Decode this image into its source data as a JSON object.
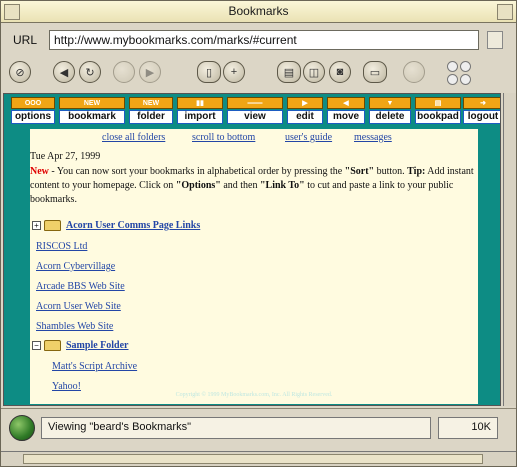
{
  "window": {
    "title": "Bookmarks"
  },
  "urlbar": {
    "label": "URL",
    "value": "http://www.mybookmarks.com/marks/#current"
  },
  "nav": {
    "buttons": [
      "stop",
      "back",
      "reload",
      "forward",
      "home",
      "page-view",
      "new-page",
      "hotlist",
      "history",
      "save",
      "print",
      "search"
    ]
  },
  "toolbar": {
    "items": [
      {
        "label": "options",
        "icon": "OOO"
      },
      {
        "label": "bookmark",
        "icon": "NEW"
      },
      {
        "label": "folder",
        "icon": "NEW"
      },
      {
        "label": "import",
        "icon": "▮▮"
      },
      {
        "label": "view",
        "icon": "═══"
      },
      {
        "label": "edit",
        "icon": "▶"
      },
      {
        "label": "move",
        "icon": "◀"
      },
      {
        "label": "delete",
        "icon": "▼"
      },
      {
        "label": "bookpad",
        "icon": "▤"
      },
      {
        "label": "logout",
        "icon": "➜"
      }
    ]
  },
  "page": {
    "top_links": [
      "close all folders",
      "scroll to bottom",
      "user's guide",
      "messages"
    ],
    "date": "Tue Apr 27, 1999",
    "news": {
      "new_label": "New",
      "text_part1": " - You can now sort your bookmarks in alphabetical order by pressing the ",
      "sort_word": "\"Sort\"",
      "text_part2": " button. ",
      "tip_word": "Tip:",
      "text_part3": " Add instant content to your homepage. Click on ",
      "options_word": "\"Options\"",
      "text_part4": " and then ",
      "linkto_word": "\"Link To\"",
      "text_part5": " to cut and paste a link to your public bookmarks."
    },
    "bookmarks": [
      {
        "label": "Acorn User Comms Page Links",
        "folder": true,
        "expanded": false
      },
      {
        "label": "RISCOS Ltd",
        "folder": false
      },
      {
        "label": "Acorn Cybervillage",
        "folder": false
      },
      {
        "label": "Arcade BBS Web Site",
        "folder": false
      },
      {
        "label": "Acorn User Web Site",
        "folder": false
      },
      {
        "label": "Shambles Web Site",
        "folder": false
      },
      {
        "label": "Sample Folder",
        "folder": true,
        "expanded": true
      },
      {
        "label": "Matt's Script Archive",
        "folder": false,
        "child": true
      },
      {
        "label": "Yahoo!",
        "folder": false,
        "child": true
      }
    ],
    "copyright": "Copyright © 1999 MyBookmarks.com, Inc. All Rights Reserved."
  },
  "status": {
    "text": "Viewing \"beard's Bookmarks\"",
    "size": "10K"
  },
  "colors": {
    "page_bg": "#0d8c84",
    "content_bg": "#fffbe0",
    "new_red": "#e00000",
    "link": "#2346a6",
    "toolbar_icon": "#f0a515"
  }
}
